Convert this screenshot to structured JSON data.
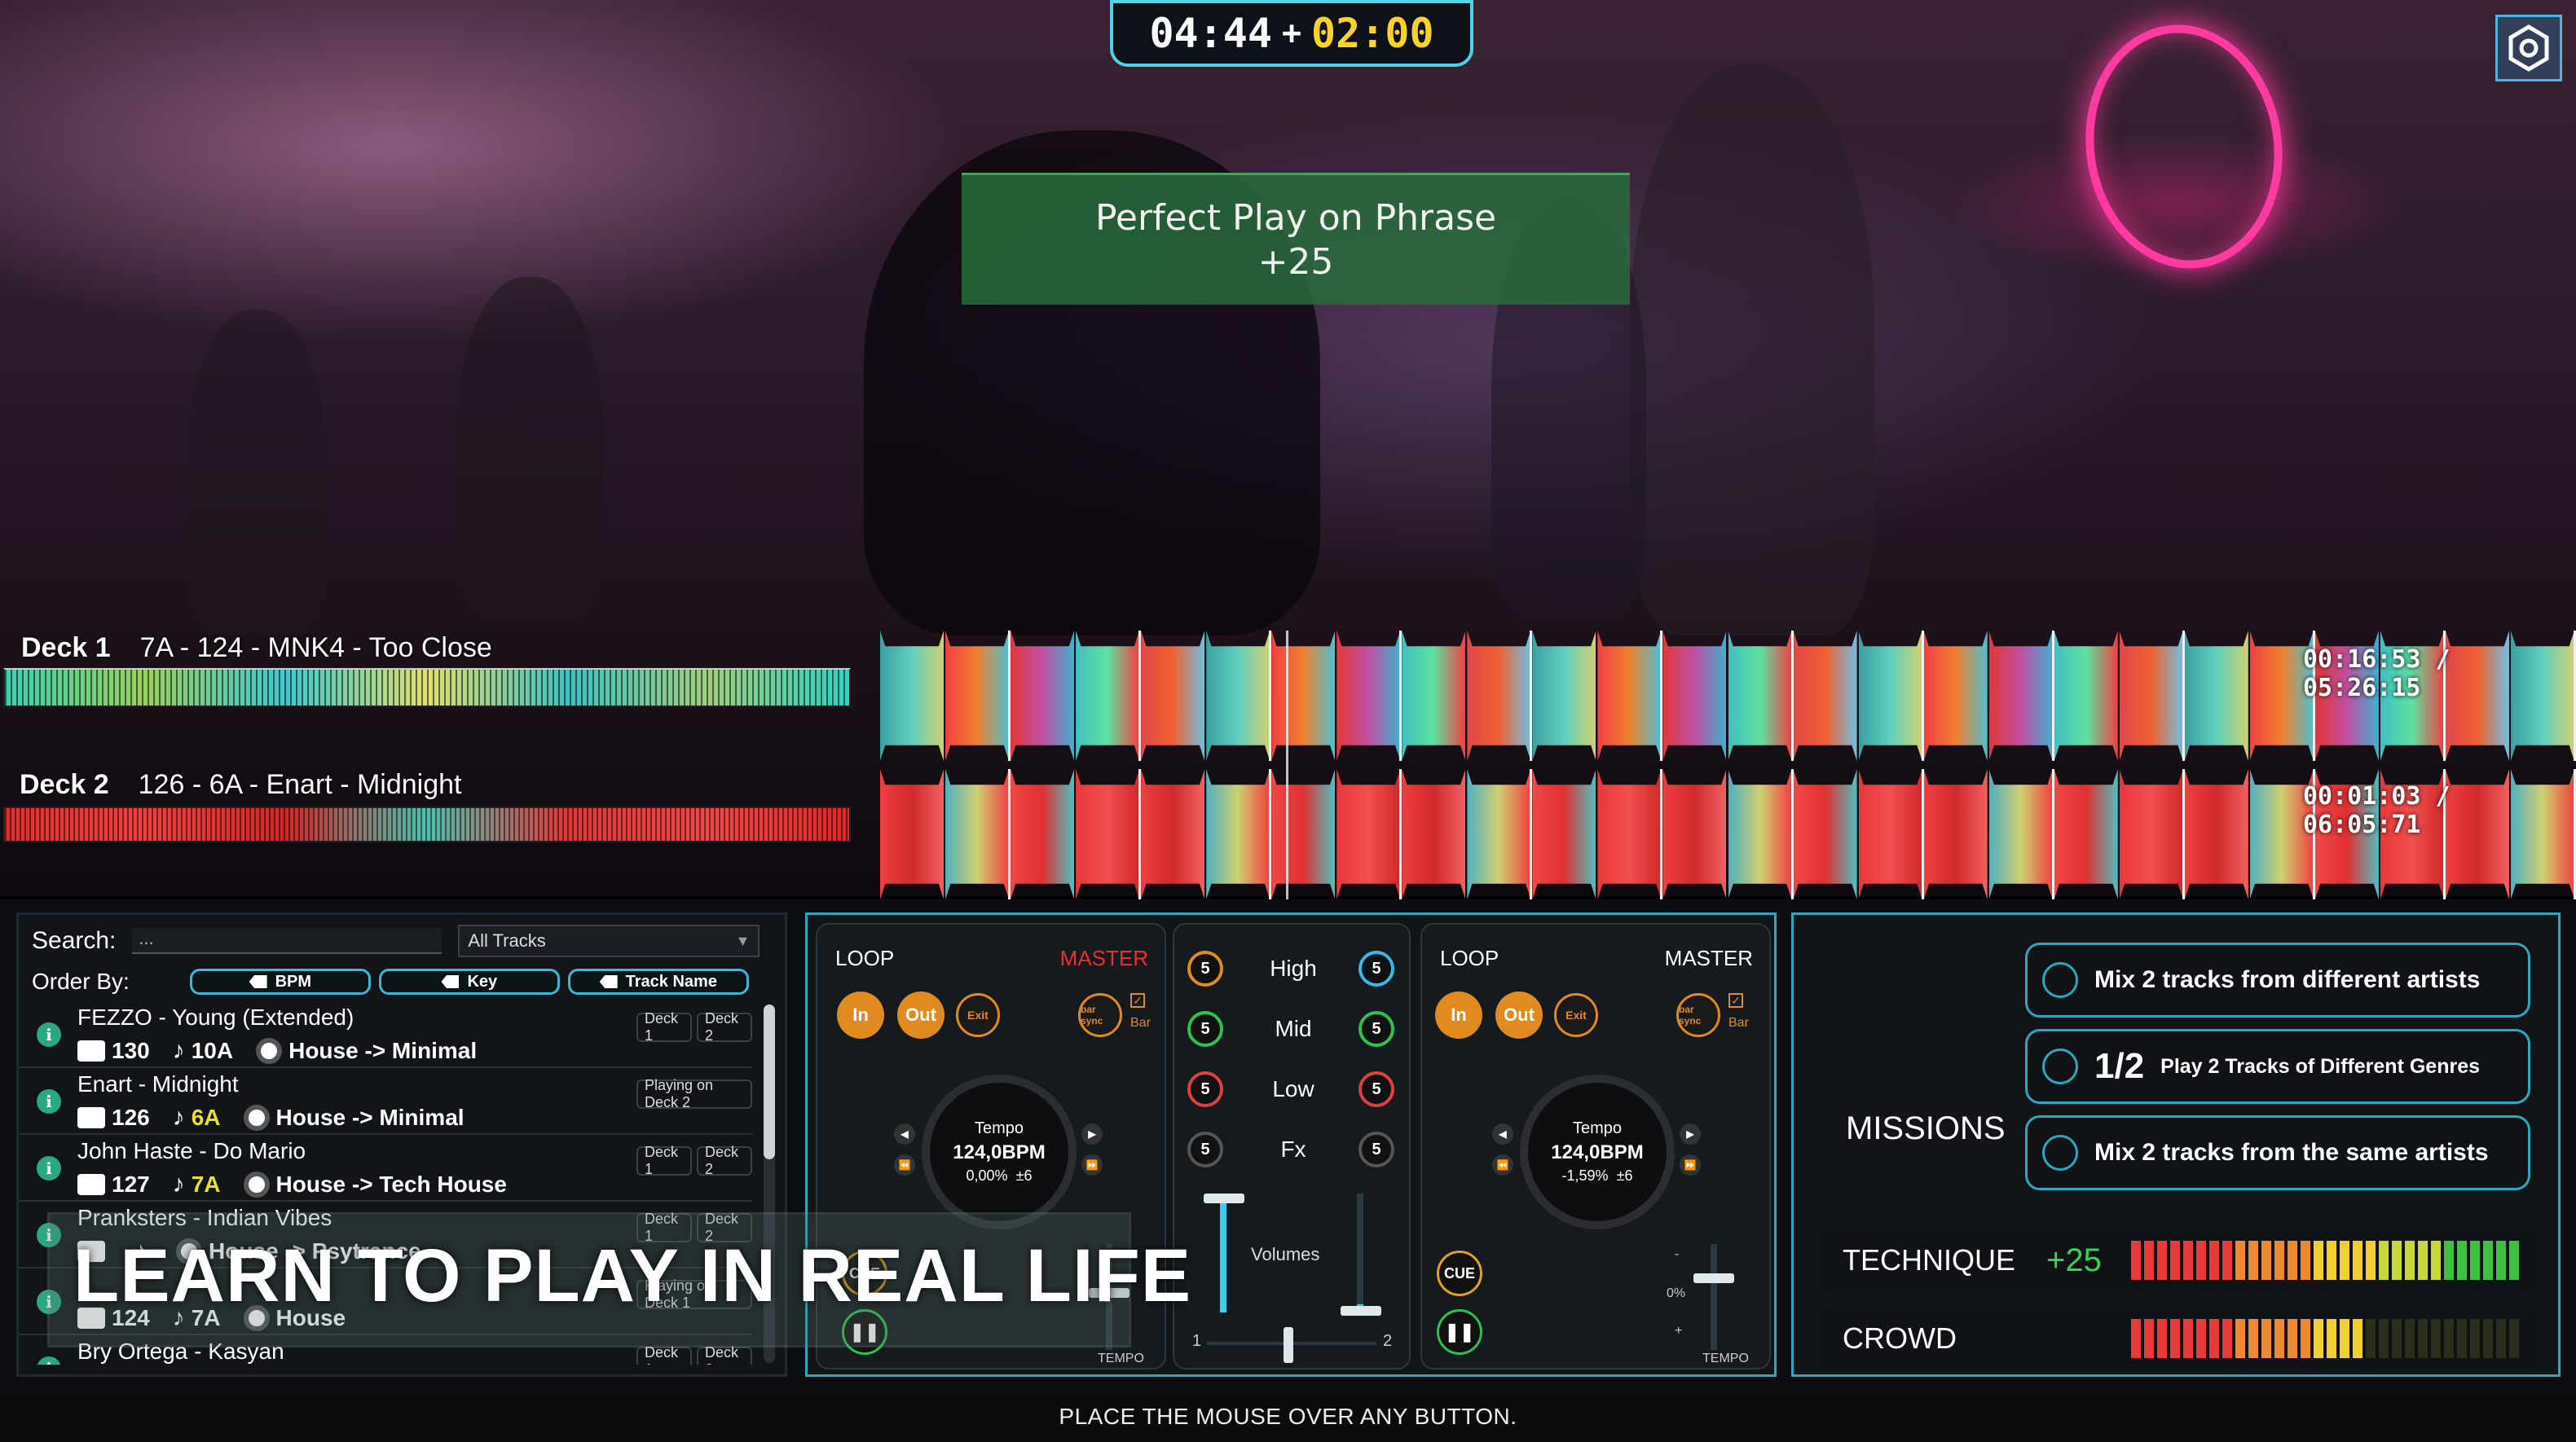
{
  "hud": {
    "time_elapsed": "04:44",
    "time_plus": "+",
    "time_bonus": "02:00",
    "phrase_line1": "Perfect Play on Phrase",
    "phrase_line2": "+25",
    "settings_icon": "hexagon-gear-icon",
    "colors": {
      "timer_border": "#4fd3e8",
      "timer_bonus": "#ffd22a",
      "phrase_bg": "#2b6e3c"
    }
  },
  "decks": [
    {
      "label": "Deck 1",
      "track": "7A - 124 - MNK4 - Too Close",
      "time": "00:16:53 / 05:26:15"
    },
    {
      "label": "Deck 2",
      "track": "126 - 6A - Enart - Midnight",
      "time": "00:01:03 / 06:05:71"
    }
  ],
  "library": {
    "search_label": "Search:",
    "search_value": "...",
    "filter_value": "All Tracks",
    "order_label": "Order By:",
    "order_buttons": [
      "BPM",
      "Key",
      "Track Name"
    ],
    "tracks": [
      {
        "name": "FEZZO - Young (Extended)",
        "bpm": "130",
        "key": "10A",
        "key_color": "#ffffff",
        "genre": "House -> Minimal",
        "tags": [
          "Deck 1",
          "Deck 2"
        ]
      },
      {
        "name": "Enart - Midnight",
        "bpm": "126",
        "key": "6A",
        "key_color": "#e8e030",
        "genre": "House -> Minimal",
        "tags": [
          "Playing on Deck 2"
        ]
      },
      {
        "name": "John Haste - Do Mario",
        "bpm": "127",
        "key": "7A",
        "key_color": "#e8e030",
        "genre": "House -> Tech House",
        "tags": [
          "Deck 1",
          "Deck 2"
        ]
      },
      {
        "name": "Pranksters - Indian Vibes",
        "bpm": "",
        "key": "",
        "key_color": "#ffffff",
        "genre": "House -> Psytrance",
        "tags": [
          "Deck 1",
          "Deck 2"
        ]
      },
      {
        "name": "",
        "bpm": "124",
        "key": "7A",
        "key_color": "#ffffff",
        "genre": "House",
        "tags": [
          "Playing on Deck 1"
        ]
      },
      {
        "name": "Bry Ortega - Kasyan",
        "bpm": "",
        "key": "",
        "key_color": "#ffffff",
        "genre": "",
        "tags": [
          "Deck 1",
          "Deck 2"
        ]
      }
    ]
  },
  "dj": {
    "left": {
      "loop": "LOOP",
      "master": "MASTER",
      "master_color": "#e83030",
      "in": "In",
      "out": "Out",
      "exit": "Exit",
      "sync": "bar sync",
      "bar": "Bar",
      "tempo_label": "Tempo",
      "bpm": "124,0BPM",
      "pct": "0,00%",
      "range": "±6",
      "cue": "CUE",
      "pause": "Pause",
      "tempo_fader": "TEMPO"
    },
    "right": {
      "loop": "LOOP",
      "master": "MASTER",
      "master_color": "#ffffff",
      "in": "In",
      "out": "Out",
      "exit": "Exit",
      "sync": "bar sync",
      "bar": "Bar",
      "tempo_label": "Tempo",
      "bpm": "124,0BPM",
      "pct": "-1,59%",
      "range": "±6",
      "cue": "CUE",
      "pause": "Pause",
      "tempo_fader": "TEMPO",
      "fader_top": "-",
      "fader_mid": "0%",
      "fader_bot": "+"
    },
    "mixer": {
      "eq": [
        {
          "label": "High",
          "value": "5"
        },
        {
          "label": "Mid",
          "value": "5"
        },
        {
          "label": "Low",
          "value": "5"
        },
        {
          "label": "Fx",
          "value": "5"
        }
      ],
      "volumes_label": "Volumes",
      "crossfader_left": "1",
      "crossfader_right": "2"
    }
  },
  "missions": {
    "title": "MISSIONS",
    "items": [
      {
        "prefix": "",
        "text": "Mix 2 tracks from different artists"
      },
      {
        "prefix": "1/2",
        "text": "Play 2 Tracks of Different Genres"
      },
      {
        "prefix": "",
        "text": "Mix 2 tracks from the same artists"
      }
    ],
    "technique_label": "TECHNIQUE",
    "technique_bonus": "+25",
    "technique_level": 1.0,
    "crowd_label": "CROWD",
    "crowd_level": 0.6
  },
  "banner": "LEARN TO PLAY IN REAL LIFE",
  "hint": "PLACE THE MOUSE OVER ANY BUTTON."
}
